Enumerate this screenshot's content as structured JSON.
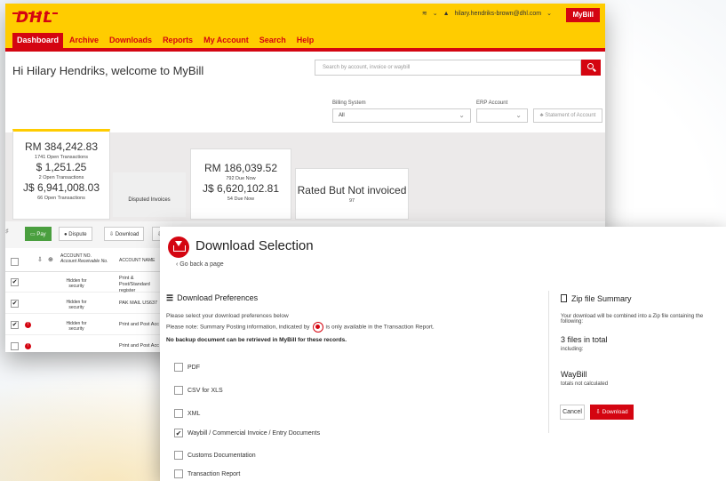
{
  "colors": {
    "dhl_yellow": "#ffcc00",
    "dhl_red": "#d40511",
    "pay_green": "#4a9f3f"
  },
  "header": {
    "logo": "DHL",
    "user_email": "hilary.hendriks-brown@dhl.com",
    "app_button": "MyBill",
    "nav": [
      "Dashboard",
      "Archive",
      "Downloads",
      "Reports",
      "My Account",
      "Search",
      "Help"
    ]
  },
  "dashboard": {
    "welcome": "Hi Hilary Hendriks, welcome to MyBill",
    "search_placeholder": "Search by account, invoice or waybill",
    "billing_system_label": "Billing System",
    "billing_system_value": "All",
    "erp_label": "ERP Account",
    "statement_button": "Statement of Account",
    "card1": {
      "amount1": "RM 384,242.83",
      "sub1": "1741 Open Transactions",
      "amount2": "$ 1,251.25",
      "sub2": "2 Open Transactions",
      "amount3": "J$ 6,941,008.03",
      "sub3": "66 Open Transactions"
    },
    "disputed_tab": "Disputed Invoices",
    "card2": {
      "amount1": "RM 186,039.52",
      "sub1": "792 Due Now",
      "amount2": "J$ 6,620,102.81",
      "sub2": "54 Due Now"
    },
    "card3": {
      "title": "Rated But Not invoiced",
      "count": "97"
    },
    "toolbar": {
      "pay": "Pay",
      "dispute": "Dispute",
      "download": "Download"
    },
    "table_headers": {
      "account_no": "ACCOUNT NO.",
      "account_receivable": "Account Receivable No.",
      "account_name": "ACCOUNT NAME"
    },
    "rows": [
      {
        "name": "Print & Post/Standard register",
        "hidden": "Hidden for security",
        "checked": "✔"
      },
      {
        "name": "PAK MAIL US637",
        "hidden": "Hidden for security",
        "checked": "✔"
      },
      {
        "name": "Print and Post Acc",
        "hidden": "Hidden for security",
        "checked": "✔"
      },
      {
        "name": "Print and Post Acc",
        "hidden": "",
        "checked": ""
      }
    ]
  },
  "download": {
    "title": "Download Selection",
    "go_back": "Go back a page",
    "prefs_title": "Download Preferences",
    "note1": "Please select your download preferences below",
    "note2a": "Please note: Summary Posting information, indicated by",
    "note2b": "is only available in the Transaction Report.",
    "note3": "No backup document can be retrieved in MyBill for these records.",
    "options": [
      {
        "label": "PDF",
        "checked": ""
      },
      {
        "label": "CSV for XLS",
        "checked": ""
      },
      {
        "label": "XML",
        "checked": ""
      },
      {
        "label": "Waybill / Commercial Invoice / Entry Documents",
        "checked": "✔"
      },
      {
        "label": "Customs Documentation",
        "checked": ""
      },
      {
        "label": "Transaction Report",
        "checked": ""
      }
    ],
    "zip_title": "Zip file Summary",
    "zip_desc": "Your download will be combined into a Zip file containing the following:",
    "files_total": "3 files in total",
    "including": "including:",
    "waybill": "WayBill",
    "totals_note": "totals not calculated",
    "cancel": "Cancel",
    "download_button": "Download"
  }
}
